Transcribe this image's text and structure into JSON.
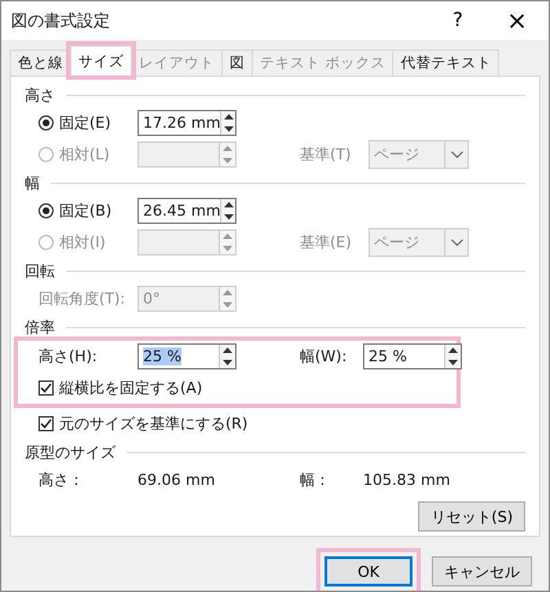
{
  "window": {
    "title": "図の書式設定",
    "help": "?",
    "close": "×"
  },
  "tabs": [
    {
      "label": "色と線",
      "selected": false,
      "disabled": false,
      "highlighted": false
    },
    {
      "label": "サイズ",
      "selected": true,
      "disabled": false,
      "highlighted": true
    },
    {
      "label": "レイアウト",
      "selected": false,
      "disabled": true,
      "highlighted": false
    },
    {
      "label": "図",
      "selected": false,
      "disabled": false,
      "highlighted": false
    },
    {
      "label": "テキスト ボックス",
      "selected": false,
      "disabled": true,
      "highlighted": false
    },
    {
      "label": "代替テキスト",
      "selected": false,
      "disabled": false,
      "highlighted": false
    }
  ],
  "sections": [
    {
      "title": "高さ",
      "rows": [
        {
          "kind": "radio",
          "label": "固定(E)",
          "selected": true,
          "disabled": false,
          "highlighted": false,
          "field": {
            "value": "17.26 mm",
            "disabled": false
          }
        },
        {
          "kind": "radio",
          "label": "相対(L)",
          "selected": false,
          "disabled": true,
          "highlighted": false,
          "field": {
            "disabled": true
          },
          "base": {
            "label": "基準(T)",
            "value": "ページ",
            "disabled": true
          }
        }
      ]
    },
    {
      "title": "幅",
      "rows": [
        {
          "kind": "radio",
          "label": "固定(B)",
          "selected": true,
          "disabled": false,
          "highlighted": false,
          "field": {
            "value": "26.45 mm",
            "disabled": false
          }
        },
        {
          "kind": "radio",
          "label": "相対(I)",
          "selected": false,
          "disabled": true,
          "highlighted": false,
          "field": {
            "disabled": true
          },
          "base": {
            "label": "基準(E)",
            "value": "ページ",
            "disabled": true
          }
        }
      ]
    },
    {
      "title": "回転",
      "rows": [
        {
          "kind": "field",
          "label": "回転角度(T):",
          "disabled": true,
          "highlighted": false,
          "field": {
            "value": "0°",
            "disabled": true
          }
        }
      ]
    },
    {
      "title": "倍率",
      "rows": [
        {
          "kind": "pair",
          "label": "高さ(H):",
          "highlighted": true,
          "field": {
            "value": "25 %",
            "disabled": false,
            "text_selected": true
          },
          "label2": "幅(W):",
          "field2": {
            "value": "25 %",
            "disabled": false,
            "text_selected": false
          }
        },
        {
          "kind": "checkbox",
          "label": "縦横比を固定する(A)",
          "checked": true,
          "highlighted": true
        },
        {
          "kind": "checkbox",
          "label": "元のサイズを基準にする(R)",
          "checked": true,
          "highlighted": false
        }
      ]
    },
    {
      "title": "原型のサイズ",
      "rows": [
        {
          "kind": "info",
          "label": "高さ：",
          "value": "69.06 mm",
          "label2": "幅：",
          "value2": "105.83 mm",
          "highlighted": false
        }
      ],
      "button": "リセット(S)"
    }
  ],
  "buttons": [
    {
      "label": "OK",
      "default": true,
      "highlighted": true
    },
    {
      "label": "キャンセル",
      "default": false,
      "highlighted": false
    }
  ]
}
